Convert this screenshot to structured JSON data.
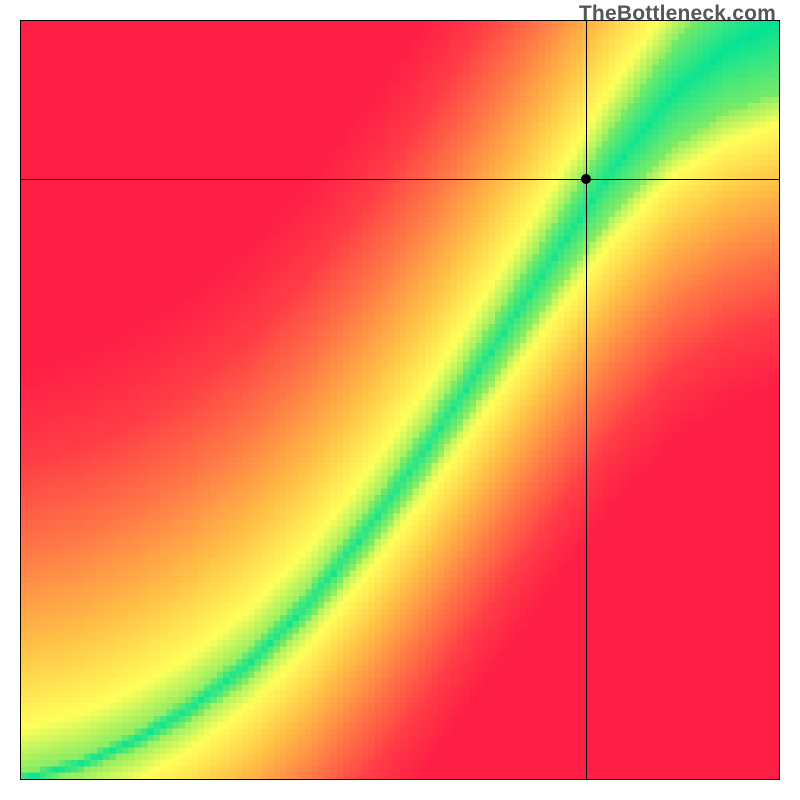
{
  "watermark": "TheBottleneck.com",
  "chart_data": {
    "type": "heatmap",
    "title": "",
    "xlabel": "",
    "ylabel": "",
    "xlim": [
      0,
      1
    ],
    "ylim": [
      0,
      1
    ],
    "grid": false,
    "crosshair": {
      "x": 0.745,
      "y": 0.792
    },
    "ridge": {
      "comment": "Approximate centerline of the green optimal band, y as a function of x (normalized 0..1).",
      "x": [
        0.0,
        0.08,
        0.15,
        0.22,
        0.3,
        0.38,
        0.46,
        0.54,
        0.62,
        0.7,
        0.78,
        0.86,
        0.93,
        1.0
      ],
      "y": [
        0.0,
        0.02,
        0.05,
        0.09,
        0.15,
        0.23,
        0.33,
        0.44,
        0.56,
        0.68,
        0.8,
        0.9,
        0.96,
        1.0
      ]
    },
    "band_halfwidth": {
      "comment": "Approximate half-width of the green band (in normalized units) as a function of x.",
      "x": [
        0.0,
        0.1,
        0.25,
        0.4,
        0.55,
        0.7,
        0.85,
        1.0
      ],
      "w": [
        0.006,
        0.01,
        0.018,
        0.026,
        0.035,
        0.048,
        0.068,
        0.095
      ]
    },
    "red_pull": {
      "comment": "Relative strength of red on the two sides of the ridge. Higher = redder sooner. Upper-left side vs lower-right side.",
      "upper_left": 1.0,
      "lower_right": 1.35
    },
    "palette": {
      "comment": "Color stops for distance-from-ridge mapping. t=0 on ridge, t=1 far away.",
      "stops": [
        {
          "t": 0.0,
          "color": [
            0,
            227,
            150
          ]
        },
        {
          "t": 0.12,
          "color": [
            130,
            235,
            100
          ]
        },
        {
          "t": 0.22,
          "color": [
            255,
            255,
            90
          ]
        },
        {
          "t": 0.4,
          "color": [
            255,
            190,
            70
          ]
        },
        {
          "t": 0.6,
          "color": [
            255,
            120,
            70
          ]
        },
        {
          "t": 0.8,
          "color": [
            255,
            60,
            70
          ]
        },
        {
          "t": 1.0,
          "color": [
            255,
            30,
            70
          ]
        }
      ]
    },
    "resolution": 120
  }
}
